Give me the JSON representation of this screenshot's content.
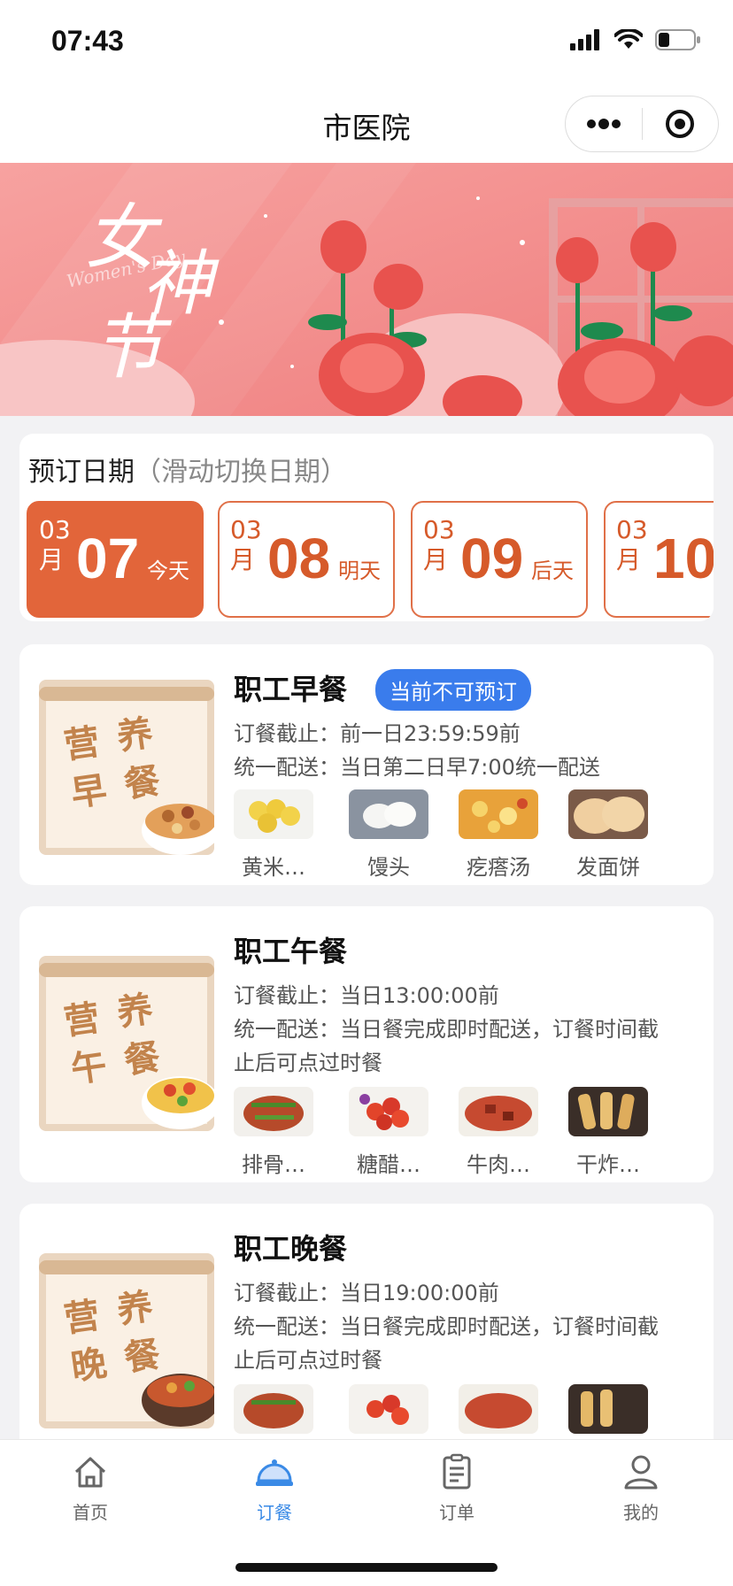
{
  "status": {
    "time": "07:43"
  },
  "nav": {
    "title": "市医院"
  },
  "banner": {
    "title_lines": [
      "女",
      "神",
      "节"
    ],
    "script_text": "Women's Day"
  },
  "booking": {
    "label": "预订日期",
    "hint": "（滑动切换日期）",
    "dates": [
      {
        "month": "03",
        "month_suffix": "月",
        "day": "07",
        "relative": "今天",
        "active": true
      },
      {
        "month": "03",
        "month_suffix": "月",
        "day": "08",
        "relative": "明天",
        "active": false
      },
      {
        "month": "03",
        "month_suffix": "月",
        "day": "09",
        "relative": "后天",
        "active": false
      },
      {
        "month": "03",
        "month_suffix": "月",
        "day": "10",
        "relative": "",
        "active": false
      }
    ]
  },
  "meals": [
    {
      "name": "职工早餐",
      "badge": "当前不可预订",
      "img_text": [
        "营",
        "养",
        "早",
        "餐"
      ],
      "deadline": "订餐截止：前一日23:59:59前",
      "delivery_1": "统一配送：当日第二日早7:00统一配送",
      "delivery_2": "",
      "dishes": [
        "黄米…",
        "馒头",
        "疙瘩汤",
        "发面饼"
      ]
    },
    {
      "name": "职工午餐",
      "badge": "",
      "img_text": [
        "营",
        "养",
        "午",
        "餐"
      ],
      "deadline": "订餐截止：当日13:00:00前",
      "delivery_1": "统一配送：当日餐完成即时配送，订餐时间截",
      "delivery_2": "止后可点过时餐",
      "dishes": [
        "排骨…",
        "糖醋…",
        "牛肉…",
        "干炸…"
      ]
    },
    {
      "name": "职工晚餐",
      "badge": "",
      "img_text": [
        "营",
        "养",
        "晚",
        "餐"
      ],
      "deadline": "订餐截止：当日19:00:00前",
      "delivery_1": "统一配送：当日餐完成即时配送，订餐时间截",
      "delivery_2": "止后可点过时餐",
      "dishes": [
        "",
        "",
        "",
        ""
      ]
    }
  ],
  "tabs": [
    {
      "label": "首页",
      "icon": "home-icon",
      "active": false
    },
    {
      "label": "订餐",
      "icon": "food-cloche-icon",
      "active": true
    },
    {
      "label": "订单",
      "icon": "order-list-icon",
      "active": false
    },
    {
      "label": "我的",
      "icon": "person-icon",
      "active": false
    }
  ],
  "colors": {
    "accent": "#e2653a",
    "badge": "#3a7cec",
    "tab_active": "#3a8ae6",
    "banner_bg": "#f48a8a"
  }
}
